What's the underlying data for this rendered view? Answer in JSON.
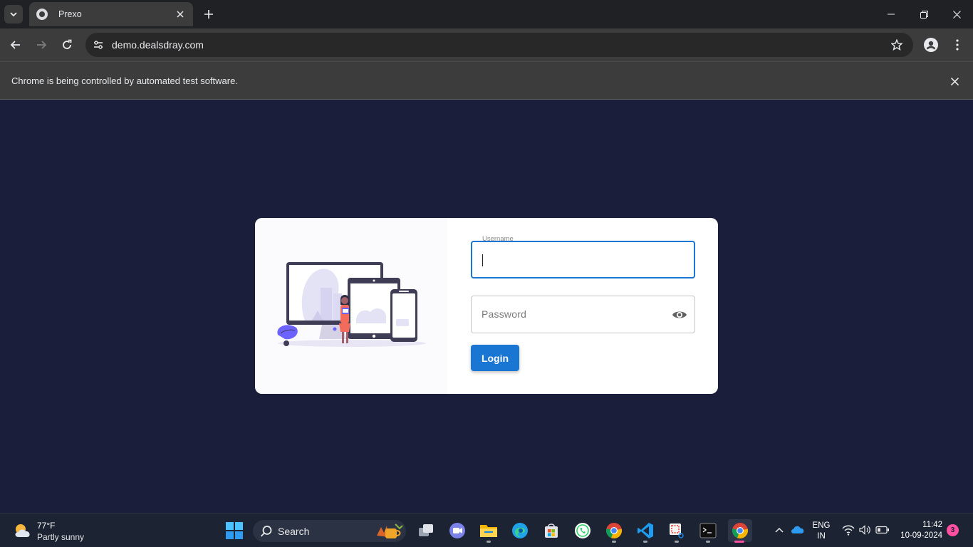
{
  "browser": {
    "tab": {
      "title": "Prexo",
      "icon": "globe-icon"
    },
    "address": {
      "url": "demo.dealsdray.com"
    },
    "infobar": {
      "message": "Chrome is being controlled by automated test software."
    }
  },
  "login": {
    "username": {
      "label": "Username",
      "value": ""
    },
    "password": {
      "placeholder": "Password",
      "visibility_icon": "eye-icon"
    },
    "button_label": "Login",
    "accent_color": "#1976d2"
  },
  "page_background": "#1b1e3b",
  "taskbar": {
    "weather": {
      "temperature": "77°F",
      "condition": "Partly sunny",
      "icon": "partly-sunny-icon"
    },
    "search_label": "Search",
    "apps": [
      {
        "name": "windows-start"
      },
      {
        "name": "task-view"
      },
      {
        "name": "teams-meet"
      },
      {
        "name": "file-explorer"
      },
      {
        "name": "edge"
      },
      {
        "name": "microsoft-store"
      },
      {
        "name": "whatsapp"
      },
      {
        "name": "chrome"
      },
      {
        "name": "vscode"
      },
      {
        "name": "snipping-tool"
      },
      {
        "name": "terminal"
      },
      {
        "name": "chrome-active"
      }
    ],
    "language": {
      "line1": "ENG",
      "line2": "IN"
    },
    "clock": {
      "time": "11:42",
      "date": "10-09-2024"
    },
    "notification_count": "3",
    "highlight_color": "#ff4fa3"
  }
}
